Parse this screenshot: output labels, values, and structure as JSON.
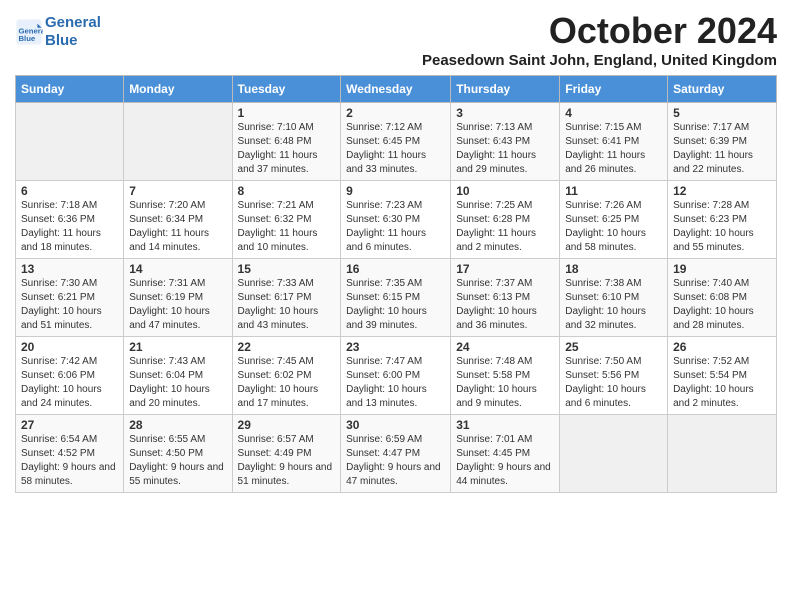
{
  "logo": {
    "line1": "General",
    "line2": "Blue"
  },
  "title": "October 2024",
  "subtitle": "Peasedown Saint John, England, United Kingdom",
  "days_of_week": [
    "Sunday",
    "Monday",
    "Tuesday",
    "Wednesday",
    "Thursday",
    "Friday",
    "Saturday"
  ],
  "weeks": [
    [
      {
        "num": "",
        "info": ""
      },
      {
        "num": "",
        "info": ""
      },
      {
        "num": "1",
        "info": "Sunrise: 7:10 AM\nSunset: 6:48 PM\nDaylight: 11 hours and 37 minutes."
      },
      {
        "num": "2",
        "info": "Sunrise: 7:12 AM\nSunset: 6:45 PM\nDaylight: 11 hours and 33 minutes."
      },
      {
        "num": "3",
        "info": "Sunrise: 7:13 AM\nSunset: 6:43 PM\nDaylight: 11 hours and 29 minutes."
      },
      {
        "num": "4",
        "info": "Sunrise: 7:15 AM\nSunset: 6:41 PM\nDaylight: 11 hours and 26 minutes."
      },
      {
        "num": "5",
        "info": "Sunrise: 7:17 AM\nSunset: 6:39 PM\nDaylight: 11 hours and 22 minutes."
      }
    ],
    [
      {
        "num": "6",
        "info": "Sunrise: 7:18 AM\nSunset: 6:36 PM\nDaylight: 11 hours and 18 minutes."
      },
      {
        "num": "7",
        "info": "Sunrise: 7:20 AM\nSunset: 6:34 PM\nDaylight: 11 hours and 14 minutes."
      },
      {
        "num": "8",
        "info": "Sunrise: 7:21 AM\nSunset: 6:32 PM\nDaylight: 11 hours and 10 minutes."
      },
      {
        "num": "9",
        "info": "Sunrise: 7:23 AM\nSunset: 6:30 PM\nDaylight: 11 hours and 6 minutes."
      },
      {
        "num": "10",
        "info": "Sunrise: 7:25 AM\nSunset: 6:28 PM\nDaylight: 11 hours and 2 minutes."
      },
      {
        "num": "11",
        "info": "Sunrise: 7:26 AM\nSunset: 6:25 PM\nDaylight: 10 hours and 58 minutes."
      },
      {
        "num": "12",
        "info": "Sunrise: 7:28 AM\nSunset: 6:23 PM\nDaylight: 10 hours and 55 minutes."
      }
    ],
    [
      {
        "num": "13",
        "info": "Sunrise: 7:30 AM\nSunset: 6:21 PM\nDaylight: 10 hours and 51 minutes."
      },
      {
        "num": "14",
        "info": "Sunrise: 7:31 AM\nSunset: 6:19 PM\nDaylight: 10 hours and 47 minutes."
      },
      {
        "num": "15",
        "info": "Sunrise: 7:33 AM\nSunset: 6:17 PM\nDaylight: 10 hours and 43 minutes."
      },
      {
        "num": "16",
        "info": "Sunrise: 7:35 AM\nSunset: 6:15 PM\nDaylight: 10 hours and 39 minutes."
      },
      {
        "num": "17",
        "info": "Sunrise: 7:37 AM\nSunset: 6:13 PM\nDaylight: 10 hours and 36 minutes."
      },
      {
        "num": "18",
        "info": "Sunrise: 7:38 AM\nSunset: 6:10 PM\nDaylight: 10 hours and 32 minutes."
      },
      {
        "num": "19",
        "info": "Sunrise: 7:40 AM\nSunset: 6:08 PM\nDaylight: 10 hours and 28 minutes."
      }
    ],
    [
      {
        "num": "20",
        "info": "Sunrise: 7:42 AM\nSunset: 6:06 PM\nDaylight: 10 hours and 24 minutes."
      },
      {
        "num": "21",
        "info": "Sunrise: 7:43 AM\nSunset: 6:04 PM\nDaylight: 10 hours and 20 minutes."
      },
      {
        "num": "22",
        "info": "Sunrise: 7:45 AM\nSunset: 6:02 PM\nDaylight: 10 hours and 17 minutes."
      },
      {
        "num": "23",
        "info": "Sunrise: 7:47 AM\nSunset: 6:00 PM\nDaylight: 10 hours and 13 minutes."
      },
      {
        "num": "24",
        "info": "Sunrise: 7:48 AM\nSunset: 5:58 PM\nDaylight: 10 hours and 9 minutes."
      },
      {
        "num": "25",
        "info": "Sunrise: 7:50 AM\nSunset: 5:56 PM\nDaylight: 10 hours and 6 minutes."
      },
      {
        "num": "26",
        "info": "Sunrise: 7:52 AM\nSunset: 5:54 PM\nDaylight: 10 hours and 2 minutes."
      }
    ],
    [
      {
        "num": "27",
        "info": "Sunrise: 6:54 AM\nSunset: 4:52 PM\nDaylight: 9 hours and 58 minutes."
      },
      {
        "num": "28",
        "info": "Sunrise: 6:55 AM\nSunset: 4:50 PM\nDaylight: 9 hours and 55 minutes."
      },
      {
        "num": "29",
        "info": "Sunrise: 6:57 AM\nSunset: 4:49 PM\nDaylight: 9 hours and 51 minutes."
      },
      {
        "num": "30",
        "info": "Sunrise: 6:59 AM\nSunset: 4:47 PM\nDaylight: 9 hours and 47 minutes."
      },
      {
        "num": "31",
        "info": "Sunrise: 7:01 AM\nSunset: 4:45 PM\nDaylight: 9 hours and 44 minutes."
      },
      {
        "num": "",
        "info": ""
      },
      {
        "num": "",
        "info": ""
      }
    ]
  ]
}
